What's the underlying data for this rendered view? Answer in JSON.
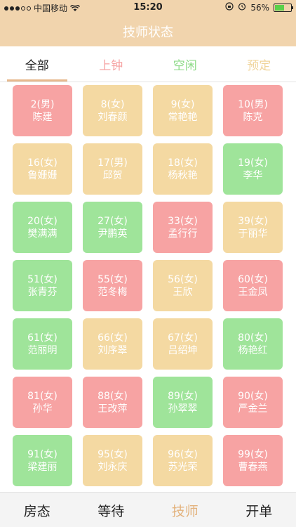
{
  "status_bar": {
    "carrier": "中国移动",
    "time": "15:20",
    "battery_percent": "56%"
  },
  "nav": {
    "title": "技师状态"
  },
  "tabs": [
    {
      "label": "全部",
      "color": "#222222",
      "active": true
    },
    {
      "label": "上钟",
      "color": "#f6a3a3",
      "active": false
    },
    {
      "label": "空闲",
      "color": "#8fdb8a",
      "active": false
    },
    {
      "label": "预定",
      "color": "#f0d49a",
      "active": false
    }
  ],
  "status_colors": {
    "busy": "#f7a3a3",
    "idle": "#9fe49a",
    "reserved": "#f4d9a2"
  },
  "technicians": [
    {
      "num": "2(男)",
      "name": "陈建",
      "status": "busy"
    },
    {
      "num": "8(女)",
      "name": "刘春颜",
      "status": "reserved"
    },
    {
      "num": "9(女)",
      "name": "常艳艳",
      "status": "reserved"
    },
    {
      "num": "10(男)",
      "name": "陈克",
      "status": "busy"
    },
    {
      "num": "16(女)",
      "name": "鲁姗姗",
      "status": "reserved"
    },
    {
      "num": "17(男)",
      "name": "邱贺",
      "status": "reserved"
    },
    {
      "num": "18(女)",
      "name": "杨秋艳",
      "status": "reserved"
    },
    {
      "num": "19(女)",
      "name": "李华",
      "status": "idle"
    },
    {
      "num": "20(女)",
      "name": "樊满满",
      "status": "idle"
    },
    {
      "num": "27(女)",
      "name": "尹鹏英",
      "status": "idle"
    },
    {
      "num": "33(女)",
      "name": "孟行行",
      "status": "busy"
    },
    {
      "num": "39(女)",
      "name": "于丽华",
      "status": "reserved"
    },
    {
      "num": "51(女)",
      "name": "张青芬",
      "status": "idle"
    },
    {
      "num": "55(女)",
      "name": "范冬梅",
      "status": "busy"
    },
    {
      "num": "56(女)",
      "name": "王欣",
      "status": "reserved"
    },
    {
      "num": "60(女)",
      "name": "王金凤",
      "status": "busy"
    },
    {
      "num": "61(女)",
      "name": "范丽明",
      "status": "idle"
    },
    {
      "num": "66(女)",
      "name": "刘序翠",
      "status": "reserved"
    },
    {
      "num": "67(女)",
      "name": "吕绍坤",
      "status": "reserved"
    },
    {
      "num": "80(女)",
      "name": "杨艳红",
      "status": "idle"
    },
    {
      "num": "81(女)",
      "name": "孙华",
      "status": "busy"
    },
    {
      "num": "88(女)",
      "name": "王改萍",
      "status": "busy"
    },
    {
      "num": "89(女)",
      "name": "孙翠翠",
      "status": "idle"
    },
    {
      "num": "90(女)",
      "name": "严金兰",
      "status": "busy"
    },
    {
      "num": "91(女)",
      "name": "梁建丽",
      "status": "idle"
    },
    {
      "num": "95(女)",
      "name": "刘永庆",
      "status": "reserved"
    },
    {
      "num": "96(女)",
      "name": "苏光荣",
      "status": "reserved"
    },
    {
      "num": "99(女)",
      "name": "曹春燕",
      "status": "busy"
    }
  ],
  "bottom_tabs": [
    {
      "label": "房态",
      "color": "#222222"
    },
    {
      "label": "等待",
      "color": "#222222"
    },
    {
      "label": "技师",
      "color": "#e3b27c"
    },
    {
      "label": "开单",
      "color": "#222222"
    }
  ]
}
